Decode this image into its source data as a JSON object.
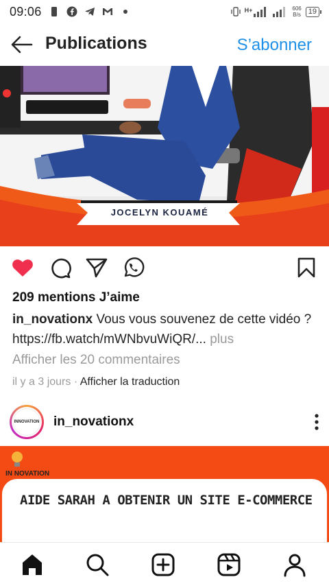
{
  "status_bar": {
    "time": "09:06",
    "network": "H+",
    "speed": "606\nB/s",
    "battery": "19"
  },
  "header": {
    "title": "Publications",
    "subscribe_label": "S’abonner"
  },
  "post": {
    "banner_name": "JOCELYN KOUAMÉ",
    "likes": "209 mentions J’aime",
    "username": "in_novationx",
    "caption": "Vous vous souvenez de cette vidéo ? https://fb.watch/mWNbvuWiQR/...",
    "more_label": "plus",
    "view_comments": "Afficher les 20 commentaires",
    "time_ago": "il y a 3 jours",
    "separator": " · ",
    "translate_label": "Afficher la traduction"
  },
  "post2": {
    "username": "in_novationx",
    "avatar_text": "INNOVATION",
    "logo_text": "IN NOVATION",
    "card_text": "AIDE SARAH  A  OBTENIR UN SITE E-COMMERCE"
  },
  "colors": {
    "accent": "#1e90e8",
    "like_red": "#ef2f4d",
    "brand_orange": "#f44a13"
  },
  "icons": {
    "back": "arrow-left-icon",
    "like": "heart-icon",
    "comment": "comment-icon",
    "share": "send-icon",
    "whatsapp": "whatsapp-icon",
    "save": "bookmark-icon",
    "more": "more-vertical-icon",
    "nav": [
      "home-icon",
      "search-icon",
      "add-icon",
      "reels-icon",
      "profile-icon"
    ]
  }
}
